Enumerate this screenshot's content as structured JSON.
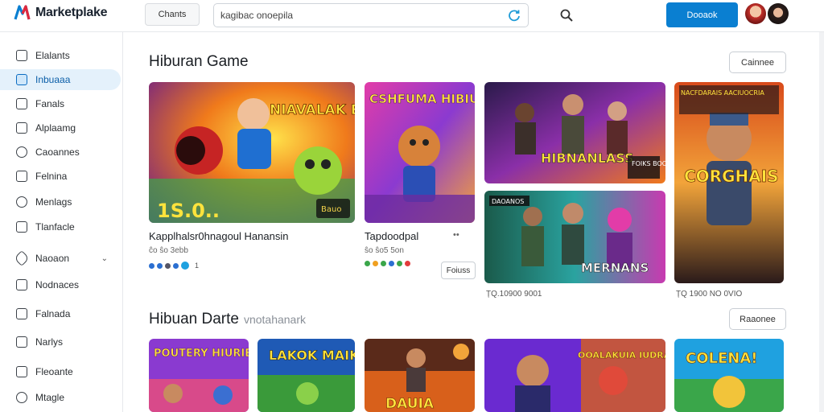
{
  "app": {
    "name": "Marketplake"
  },
  "topbar": {
    "chats_label": "Chants",
    "search_value": "kagibac onoepila",
    "primary_label": "Dooaok"
  },
  "sidebar": {
    "items": [
      {
        "label": "Elalants"
      },
      {
        "label": "Inbuaaa"
      },
      {
        "label": "Fanals"
      },
      {
        "label": "Alplaamg"
      },
      {
        "label": "Caoannes"
      },
      {
        "label": "Felnina"
      },
      {
        "label": "Menlags"
      },
      {
        "label": "Tlanfacle"
      },
      {
        "label": "Naoaon"
      },
      {
        "label": "Nodnaces"
      },
      {
        "label": "Falnada"
      },
      {
        "label": "Narlys"
      },
      {
        "label": "Fleoante"
      },
      {
        "label": "Mtagle"
      }
    ]
  },
  "section1": {
    "title": "Hiburan Game",
    "button_label": "Cainnee",
    "cards": [
      {
        "art_text": "NIAVALAK ETANAIS",
        "badge": "Bauo"
      },
      {
        "art_text": "CSHFUMA HIBIUIAES"
      },
      {
        "art_text": "HIBNANLASS",
        "badge": "FOIKS BOOAS"
      },
      {
        "art_text": "MERNANS",
        "badge": "DAOANOS"
      },
      {
        "art_text": "CORGHAIS",
        "badge": "NACFDARAIS AACIUOCRIA"
      }
    ],
    "item1": {
      "title": "Kapplhalsr0hnagoul Hanansin",
      "meta": "ĉo ŝo 3ebb",
      "rating": "1"
    },
    "item2": {
      "title": "Tapdoodpal",
      "meta": "ŝo ŝo5 5on",
      "menu": "••",
      "button_label": "Foiuss"
    },
    "caption_a": "ȚQ.10900 9001",
    "caption_b": "ȚQ 1900 NO 0VIO"
  },
  "section2": {
    "title": "Hibuan Darte",
    "subtitle": "vnotahanark",
    "button_label": "Raaonee",
    "cards": [
      {
        "art_text": "POUTERY HIURIECS"
      },
      {
        "art_text": "LAKOK MAIKES"
      },
      {
        "art_text": "DAUIA"
      },
      {
        "art_text": "OOALAKUIA IUDRAES"
      },
      {
        "art_text": "COLENA!"
      }
    ]
  },
  "colors": {
    "accent": "#0a7fd1",
    "active_bg": "#e4f1fb"
  },
  "icons": [
    "logo-icon",
    "search-icon",
    "refresh-icon",
    "chevron-down-icon",
    "chevron-right-icon"
  ]
}
